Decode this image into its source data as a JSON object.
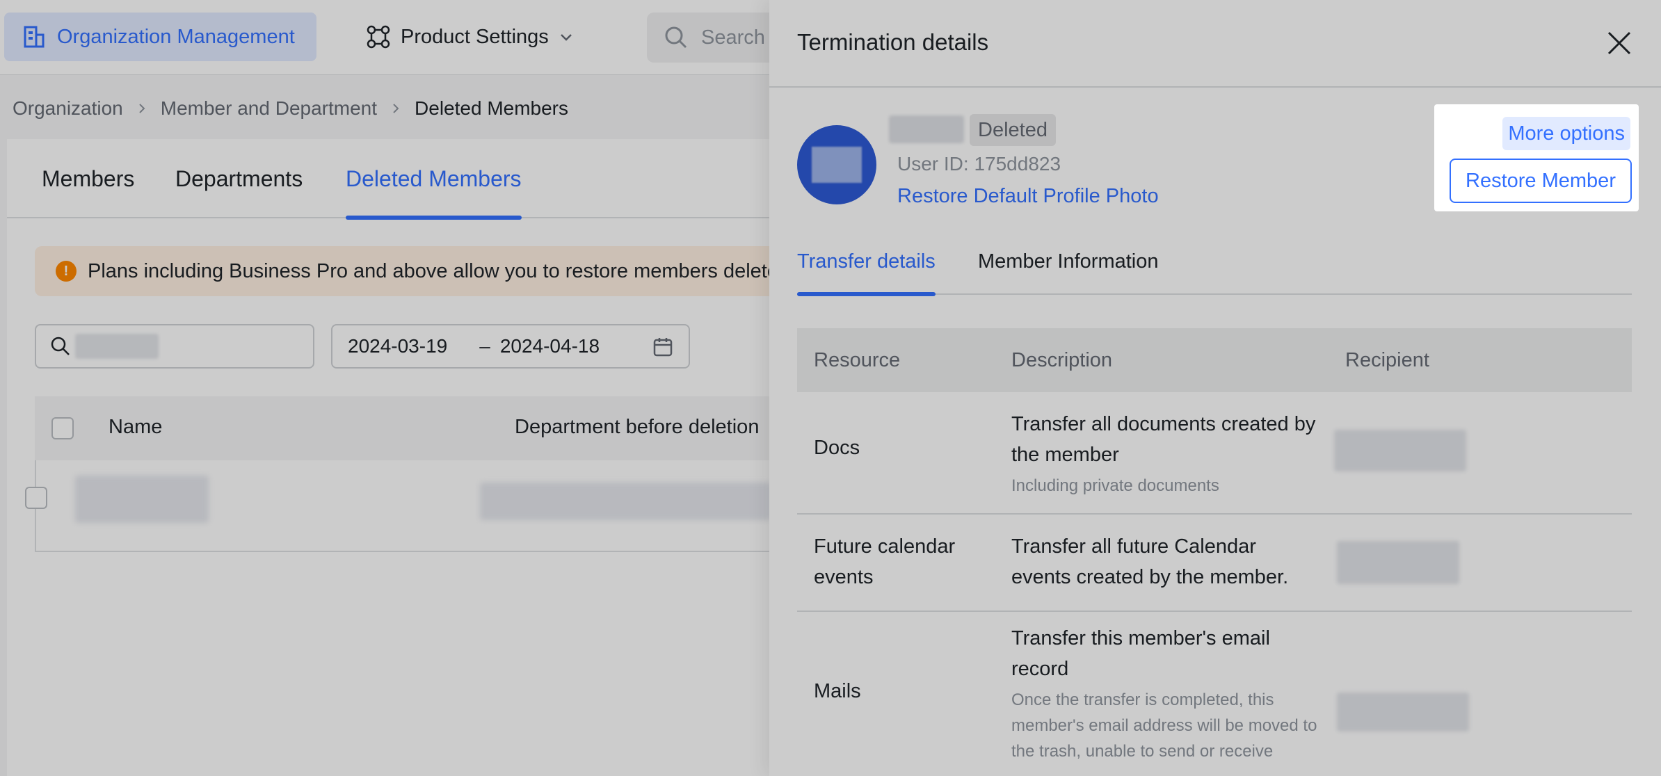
{
  "topbar": {
    "org_label": "Organization Management",
    "product_label": "Product Settings",
    "search_placeholder": "Search"
  },
  "breadcrumb": [
    "Organization",
    "Member and Department",
    "Deleted Members"
  ],
  "tabs": [
    "Members",
    "Departments",
    "Deleted Members"
  ],
  "notice": "Plans including Business Pro and above allow you to restore members deleted",
  "filters": {
    "date_start": "2024-03-19",
    "date_sep": "–",
    "date_end": "2024-04-18"
  },
  "table": {
    "headers": [
      "Name",
      "Department before deletion"
    ]
  },
  "drawer": {
    "title": "Termination details",
    "status": "Deleted",
    "user_id": "User ID: 175dd823",
    "restore_photo": "Restore Default Profile Photo",
    "more_options": "More options",
    "restore_member": "Restore Member",
    "tabs": [
      "Transfer details",
      "Member Information"
    ],
    "columns": [
      "Resource",
      "Description",
      "Recipient"
    ],
    "rows": [
      {
        "resource": "Docs",
        "desc": "Transfer all documents created by the member",
        "note": "Including private documents"
      },
      {
        "resource": "Future calendar events",
        "desc": "Transfer all future Calendar events created by the member.",
        "note": ""
      },
      {
        "resource": "Mails",
        "desc": "Transfer this member's email record",
        "note": "Once the transfer is completed, this member's email address will be moved to the trash, unable to send or receive"
      }
    ]
  },
  "colors": {
    "accent": "#3370ff",
    "warning": "#ff8800",
    "notice_bg": "#fff1e3"
  }
}
